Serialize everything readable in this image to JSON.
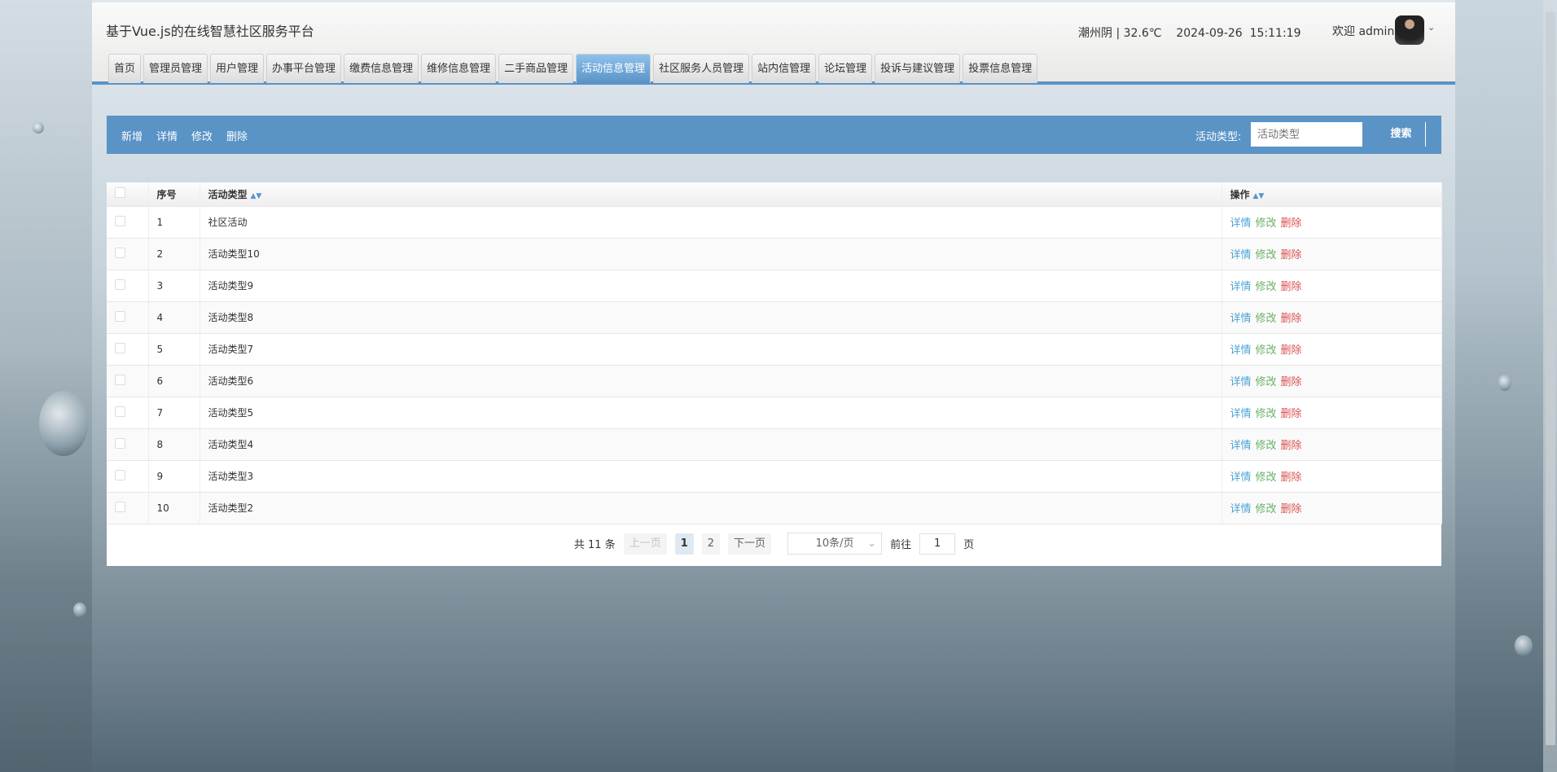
{
  "header": {
    "title": "基于Vue.js的在线智慧社区服务平台",
    "weather": "潮州阴 | 32.6℃",
    "date": "2024-09-26",
    "time": "15:11:19",
    "welcome": "欢迎 admin"
  },
  "tabs": [
    "首页",
    "管理员管理",
    "用户管理",
    "办事平台管理",
    "缴费信息管理",
    "维修信息管理",
    "二手商品管理",
    "活动信息管理",
    "社区服务人员管理",
    "站内信管理",
    "论坛管理",
    "投诉与建议管理",
    "投票信息管理"
  ],
  "active_tab": "活动信息管理",
  "toolbar": {
    "add": "新增",
    "detail": "详情",
    "edit": "修改",
    "delete": "删除",
    "search_label": "活动类型:",
    "search_placeholder": "活动类型",
    "search_button": "搜索"
  },
  "table": {
    "headers": {
      "index": "序号",
      "type": "活动类型",
      "ops": "操作"
    },
    "rows": [
      {
        "n": "1",
        "type": "社区活动"
      },
      {
        "n": "2",
        "type": "活动类型10"
      },
      {
        "n": "3",
        "type": "活动类型9"
      },
      {
        "n": "4",
        "type": "活动类型8"
      },
      {
        "n": "5",
        "type": "活动类型7"
      },
      {
        "n": "6",
        "type": "活动类型6"
      },
      {
        "n": "7",
        "type": "活动类型5"
      },
      {
        "n": "8",
        "type": "活动类型4"
      },
      {
        "n": "9",
        "type": "活动类型3"
      },
      {
        "n": "10",
        "type": "活动类型2"
      }
    ],
    "row_actions": {
      "detail": "详情",
      "edit": "修改",
      "delete": "删除"
    }
  },
  "pagination": {
    "total": "共 11 条",
    "prev": "上一页",
    "pages": [
      "1",
      "2"
    ],
    "next": "下一页",
    "size": "10条/页",
    "goto": "前往",
    "goto_value": "1",
    "page_suffix": "页"
  },
  "colors": {
    "accent": "#5a93c6",
    "detail": "#4ba3d6",
    "edit": "#67b168",
    "delete": "#d9534f"
  }
}
